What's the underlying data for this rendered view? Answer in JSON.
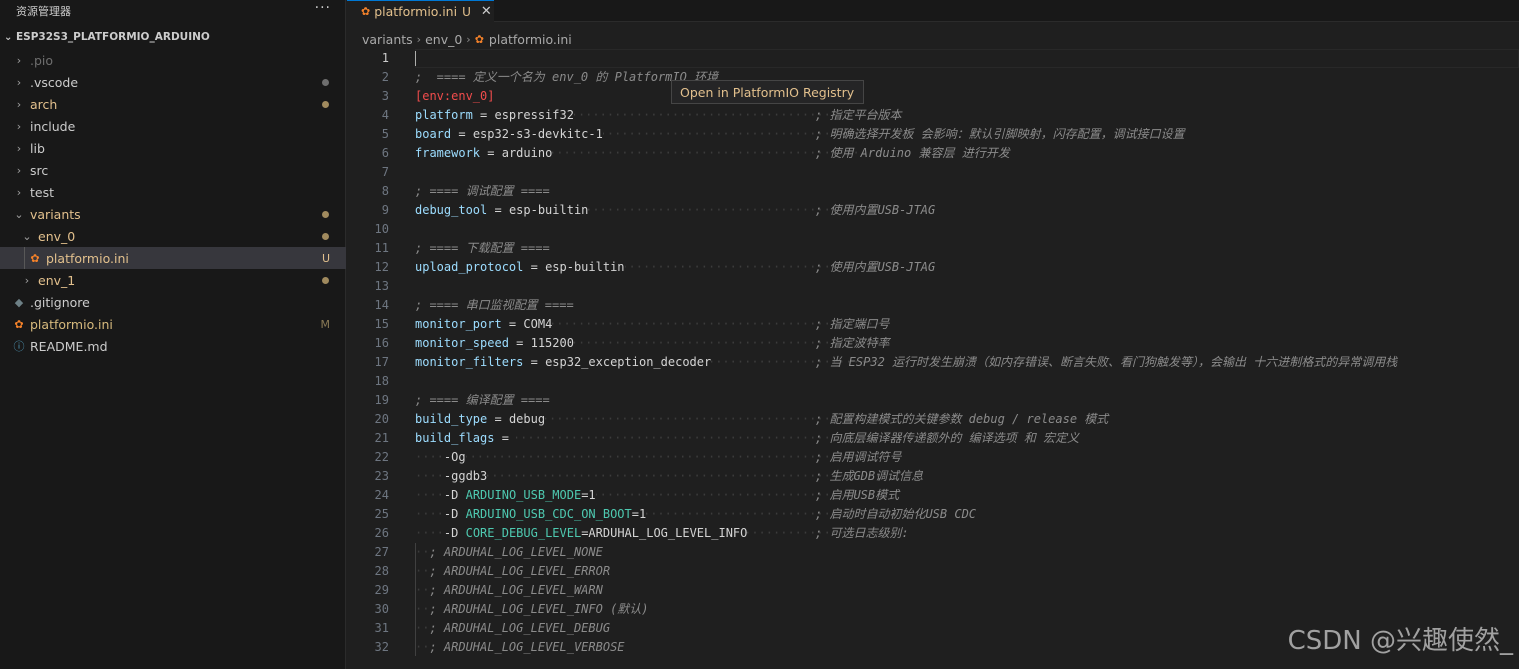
{
  "sidebar": {
    "title": "资源管理器",
    "more": "···",
    "project": "ESP32S3_PLATFORMIO_ARDUINO",
    "items": [
      {
        "label": ".pio"
      },
      {
        "label": ".vscode"
      },
      {
        "label": "arch"
      },
      {
        "label": "include"
      },
      {
        "label": "lib"
      },
      {
        "label": "src"
      },
      {
        "label": "test"
      },
      {
        "label": "variants"
      },
      {
        "label": "env_0"
      },
      {
        "label": "platformio.ini",
        "badge": "U"
      },
      {
        "label": "env_1"
      },
      {
        "label": ".gitignore"
      },
      {
        "label": "platformio.ini",
        "badge": "M"
      },
      {
        "label": "README.md"
      }
    ]
  },
  "tab": {
    "label": "platformio.ini",
    "badge": "U",
    "close": "✕"
  },
  "breadcrumb": [
    "variants",
    "env_0",
    "platformio.ini"
  ],
  "tooltip": "Open in PlatformIO Registry",
  "watermark": "CSDN @兴趣使然_",
  "editor": {
    "lines": [
      {
        "n": "1",
        "code": ""
      },
      {
        "n": "2",
        "code": ";  ==== 定义一个名为 env_0 的 PlatformIO 环境"
      },
      {
        "n": "3",
        "code": "[env:env_0]"
      },
      {
        "n": "4",
        "key": "platform",
        "val": "espressif32",
        "cmt": "; 指定平台版本"
      },
      {
        "n": "5",
        "key": "board",
        "val": "esp32-s3-devkitc-1",
        "cmt": "; 明确选择开发板 会影响：默认引脚映射，闪存配置，调试接口设置"
      },
      {
        "n": "6",
        "key": "framework",
        "val": "arduino",
        "cmt": "; 使用 Arduino 兼容层 进行开发"
      },
      {
        "n": "7",
        "code": ""
      },
      {
        "n": "8",
        "code": "; ==== 调试配置 ===="
      },
      {
        "n": "9",
        "key": "debug_tool",
        "val": "esp-builtin",
        "cmt": "; 使用内置USB-JTAG"
      },
      {
        "n": "10",
        "code": ""
      },
      {
        "n": "11",
        "code": "; ==== 下载配置 ===="
      },
      {
        "n": "12",
        "key": "upload_protocol",
        "val": "esp-builtin",
        "cmt": "; 使用内置USB-JTAG"
      },
      {
        "n": "13",
        "code": ""
      },
      {
        "n": "14",
        "code": "; ==== 串口监视配置 ===="
      },
      {
        "n": "15",
        "key": "monitor_port",
        "val": "COM4",
        "cmt": "; 指定端口号"
      },
      {
        "n": "16",
        "key": "monitor_speed",
        "val": "115200",
        "cmt": "; 指定波特率"
      },
      {
        "n": "17",
        "key": "monitor_filters",
        "val": "esp32_exception_decoder",
        "cmt": "; 当 ESP32 运行时发生崩溃（如内存错误、断言失败、看门狗触发等），会输出 十六进制格式的异常调用栈"
      },
      {
        "n": "18",
        "code": ""
      },
      {
        "n": "19",
        "code": "; ==== 编译配置 ===="
      },
      {
        "n": "20",
        "key": "build_type",
        "val": "debug",
        "cmt": "; 配置构建模式的关键参数 debug / release 模式"
      },
      {
        "n": "21",
        "key": "build_flags",
        "val": "",
        "cmt": "; 向底层编译器传递额外的 编译选项 和 宏定义"
      },
      {
        "n": "22",
        "flag": "-Og",
        "cmt": "; 启用调试符号"
      },
      {
        "n": "23",
        "flag": "-ggdb3",
        "cmt": "; 生成GDB调试信息"
      },
      {
        "n": "24",
        "flag": "-D",
        "def": "ARDUINO_USB_MODE",
        "defval": "1",
        "cmt": "; 启用USB模式"
      },
      {
        "n": "25",
        "flag": "-D",
        "def": "ARDUINO_USB_CDC_ON_BOOT",
        "defval": "1",
        "cmt": "; 启动时自动初始化USB CDC"
      },
      {
        "n": "26",
        "flag": "-D",
        "def": "CORE_DEBUG_LEVEL",
        "defval": "ARDUHAL_LOG_LEVEL_INFO",
        "cmt": "; 可选日志级别:"
      },
      {
        "n": "27",
        "sub": "; ARDUHAL_LOG_LEVEL_NONE"
      },
      {
        "n": "28",
        "sub": "; ARDUHAL_LOG_LEVEL_ERROR"
      },
      {
        "n": "29",
        "sub": "; ARDUHAL_LOG_LEVEL_WARN"
      },
      {
        "n": "30",
        "sub": "; ARDUHAL_LOG_LEVEL_INFO (默认)"
      },
      {
        "n": "31",
        "sub": "; ARDUHAL_LOG_LEVEL_DEBUG"
      },
      {
        "n": "32",
        "sub": "; ARDUHAL_LOG_LEVEL_VERBOSE"
      }
    ]
  }
}
